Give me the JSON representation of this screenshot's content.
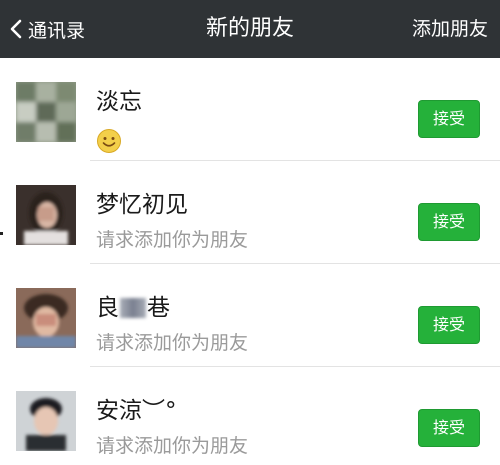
{
  "navbar": {
    "back_label": "通讯录",
    "title": "新的朋友",
    "action_label": "添加朋友"
  },
  "requests": [
    {
      "name": "淡忘",
      "subtitle_icon": "smile-emoji-icon",
      "accept_label": "接受"
    },
    {
      "name": "梦忆初见",
      "message": "请求添加你为朋友",
      "accept_label": "接受"
    },
    {
      "name_prefix": "良",
      "name_suffix": "巷",
      "name_obscured": true,
      "message": "请求添加你为朋友",
      "accept_label": "接受"
    },
    {
      "name": "安涼︶°",
      "message": "请求添加你为朋友",
      "accept_label": "接受"
    }
  ],
  "colors": {
    "navbar_bg": "#2f3336",
    "accept_green": "#25b13a",
    "subtitle_gray": "#9a9a9a"
  }
}
